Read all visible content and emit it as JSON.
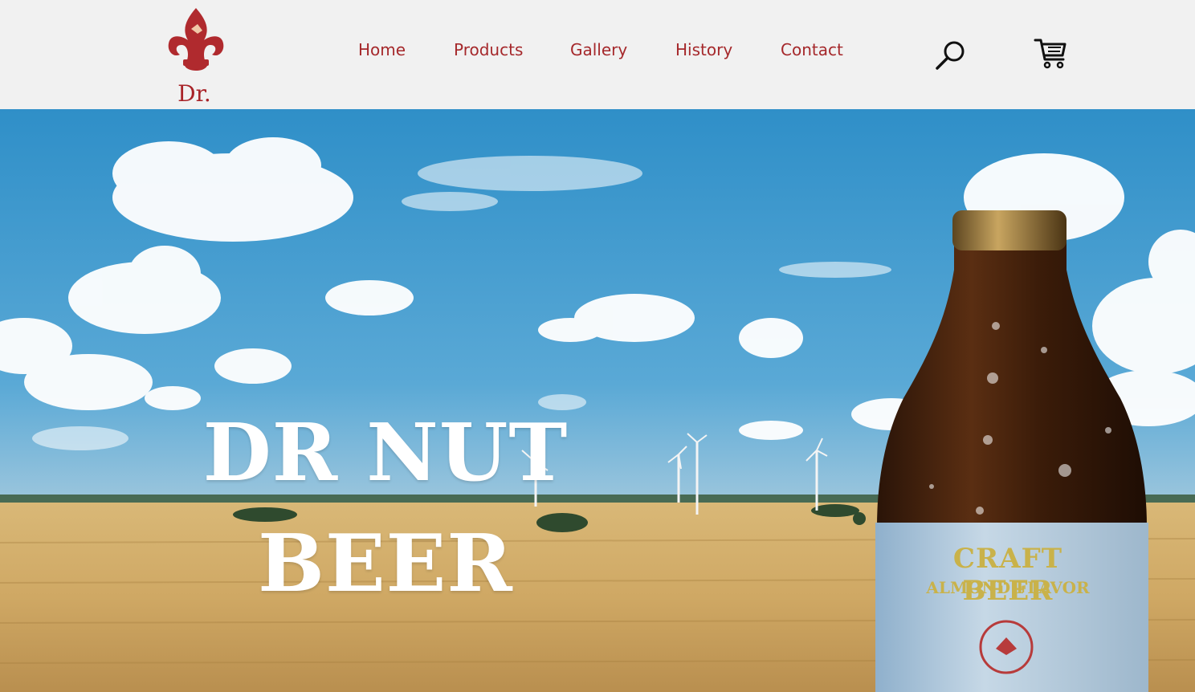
{
  "brand": {
    "logo_text": "Dr.",
    "color": "#a82328"
  },
  "nav": {
    "items": [
      {
        "label": "Home"
      },
      {
        "label": "Products"
      },
      {
        "label": "Gallery"
      },
      {
        "label": "History"
      },
      {
        "label": "Contact"
      }
    ],
    "color": "#a5282b"
  },
  "icons": {
    "search": "search-icon",
    "cart": "cart-icon"
  },
  "hero": {
    "title_line1": "DR NUT",
    "title_line2": "BEER",
    "bottle_label_line1": "CRAFT BEER",
    "bottle_label_line2": "ALMOND FLAVOR",
    "sky_color": "#3d9bd0",
    "field_color": "#d3ad6a"
  }
}
